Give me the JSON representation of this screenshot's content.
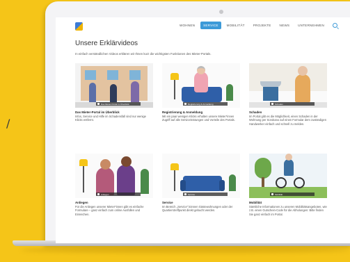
{
  "decor": {
    "slash": "/"
  },
  "nav": {
    "items": [
      "WOHNEN",
      "SERVICE",
      "MOBILITÄT",
      "PROJEKTE",
      "NEWS",
      "UNTERNEHMEN"
    ],
    "active_index": 1
  },
  "page": {
    "title": "Unsere Erklärvideos",
    "intro": "In einfach verständlichen Videos erklären wir Ihnen kurz die wichtigsten Funktionen des Mieter-Portals."
  },
  "cards": [
    {
      "title": "Das Mieter-Portal im Überblick",
      "text": "Infos, Service und Hilfe im Schadensfall sind nur wenige Klicks entfernt.",
      "caption": "Das Mieter-Portal im Überblick"
    },
    {
      "title": "Registrierung & Anmeldung",
      "text": "Mit ein paar wenigen Klicks erhalten unsere Mieter*innen Zugriff auf alle Serviceleistungen und Vorteile des Portals.",
      "caption": "Registrierung & Anmeldung"
    },
    {
      "title": "Schaden",
      "text": "Im Portal gibt es die Möglichkeit, einen Schaden in der Wohnung per Sorokano auf einen Formular dem zuständigen Handwerker einfach und schnell zu melden.",
      "caption": "Schaden"
    },
    {
      "title": "Anliegen",
      "text": "Für die Anliegen unserer Mieter*innen gibt es einfache Formulare – ganz einfach zum online Ausfüllen und Einreichen.",
      "caption": "Anliegen"
    },
    {
      "title": "Service",
      "text": "Im Bereich „Service“ können Gästewohnungen oder der Quartierstreffpunkt direkt gebucht werden.",
      "caption": "Service"
    },
    {
      "title": "Mobilität",
      "text": "Sämtliche Informationen zu unseren Mobilitätsangeboten, wie z.B. einen Gutschein-Code für die Abholungen: Bitte finden Sie ganz einfach im Portal.",
      "caption": "Mobilität"
    }
  ],
  "colors": {
    "background": "#f5c518",
    "accent": "#3d9ad8"
  },
  "icons": [
    "search-icon",
    "play-icon",
    "logo"
  ]
}
